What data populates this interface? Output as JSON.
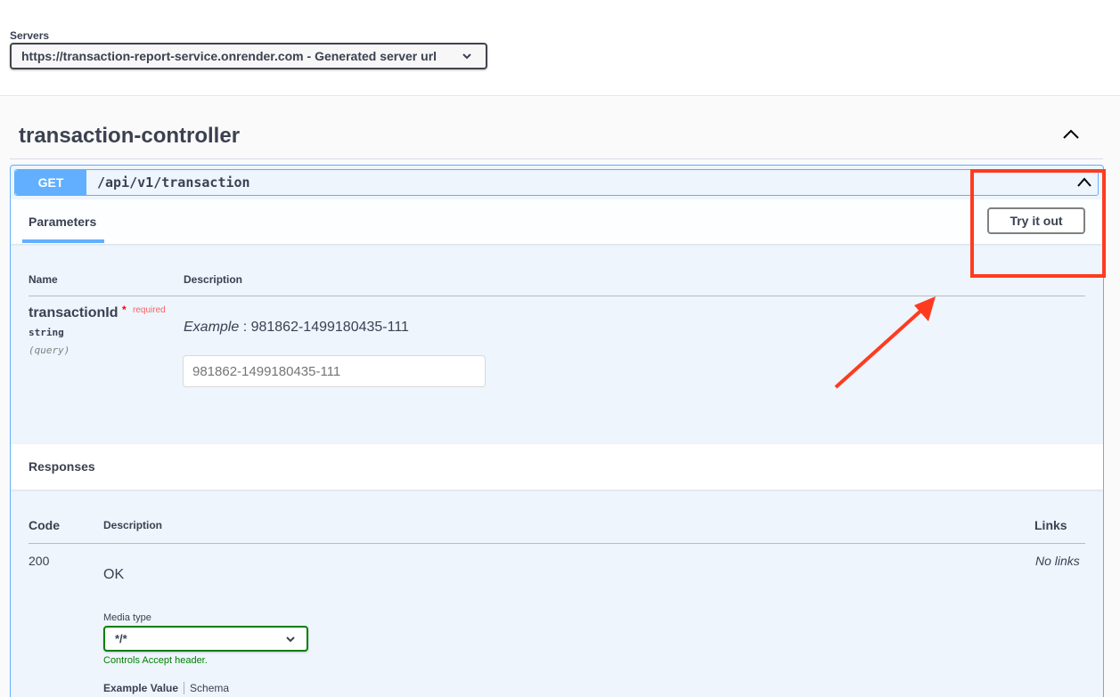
{
  "servers": {
    "label": "Servers",
    "selected": "https://transaction-report-service.onrender.com - Generated server url",
    "chevron_icon": "chevron-down-icon"
  },
  "tag": {
    "title": "transaction-controller",
    "toggle_icon": "chevron-up-icon"
  },
  "operation": {
    "method": "GET",
    "path": "/api/v1/transaction",
    "method_color": "#61affe",
    "toggle_icon": "chevron-up-icon"
  },
  "parameters": {
    "tab_label": "Parameters",
    "try_button": "Try it out",
    "col_name": "Name",
    "col_description": "Description",
    "items": [
      {
        "name": "transactionId",
        "required_mark": "*",
        "required_label": "required",
        "type": "string",
        "in": "(query)",
        "example_label": "Example",
        "example_value": " : 981862-1499180435-111",
        "placeholder": "981862-1499180435-111"
      }
    ]
  },
  "responses": {
    "title": "Responses",
    "col_code": "Code",
    "col_description": "Description",
    "col_links": "Links",
    "items": [
      {
        "code": "200",
        "description": "OK",
        "links": "No links",
        "media_type_label": "Media type",
        "media_type_value": "*/*",
        "media_hint": "Controls Accept header.",
        "example_tab": "Example Value",
        "schema_tab": "Schema"
      }
    ]
  },
  "annotation": {
    "highlight_color": "#ff3b1f"
  }
}
